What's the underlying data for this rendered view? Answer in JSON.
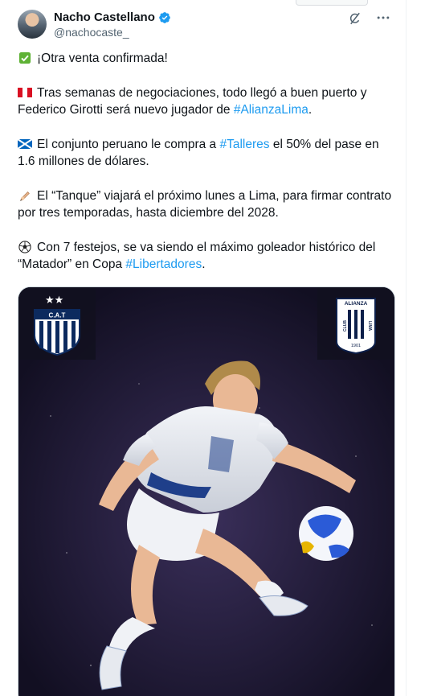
{
  "author": {
    "display_name": "Nacho Castellano",
    "handle": "@nachocaste_",
    "verified": true
  },
  "icons": {
    "verified": "verified-badge-icon",
    "grok": "grok-icon",
    "more": "more-icon"
  },
  "tweet": {
    "paragraphs": [
      {
        "emoji": "check-mark-emoji",
        "parts": [
          "¡Otra venta confirmada!"
        ]
      },
      {
        "emoji": "peru-flag-emoji",
        "text_before": "Tras semanas de negociaciones, todo llegó a buen puerto y Federico Girotti será nuevo jugador de ",
        "hashtag": "#AlianzaLima",
        "text_after": "."
      },
      {
        "emoji": "scotland-flag-emoji",
        "text_before": "El conjunto peruano le compra a ",
        "hashtag": "#Talleres",
        "text_after": " el 50% del pase en 1.6 millones de dólares."
      },
      {
        "emoji": "writing-hand-emoji",
        "parts": [
          "El “Tanque” viajará el próximo lunes a Lima, para firmar contrato por tres temporadas, hasta diciembre del 2028."
        ]
      },
      {
        "emoji": "soccer-ball-emoji",
        "text_before": "Con 7 festejos, se va siendo el máximo goleador histórico del “Matador” en Copa ",
        "hashtag": "#Libertadores",
        "text_after": "."
      }
    ]
  },
  "media": {
    "left_crest": {
      "text": "C.A.T",
      "stars": "★★"
    },
    "right_crest": {
      "top": "ALIANZA",
      "left": "CLUB",
      "right": "LIMA",
      "year": "1901"
    },
    "colors": {
      "accent": "#1d9bf0",
      "background": "#1b1630"
    }
  }
}
